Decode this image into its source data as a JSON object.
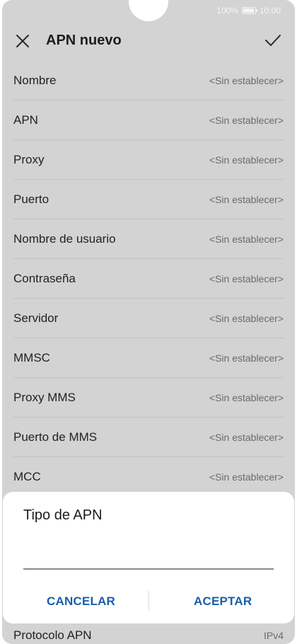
{
  "status_bar": {
    "battery_percent": "100%",
    "time": "10:00"
  },
  "toolbar": {
    "title": "APN nuevo",
    "close_icon": "close-icon",
    "confirm_icon": "check-icon"
  },
  "fields": [
    {
      "label": "Nombre",
      "value": "<Sin establecer>"
    },
    {
      "label": "APN",
      "value": "<Sin establecer>"
    },
    {
      "label": "Proxy",
      "value": "<Sin establecer>"
    },
    {
      "label": "Puerto",
      "value": "<Sin establecer>"
    },
    {
      "label": "Nombre de usuario",
      "value": "<Sin establecer>"
    },
    {
      "label": "Contraseña",
      "value": "<Sin establecer>"
    },
    {
      "label": "Servidor",
      "value": "<Sin establecer>"
    },
    {
      "label": "MMSC",
      "value": "<Sin establecer>"
    },
    {
      "label": "Proxy MMS",
      "value": "<Sin establecer>"
    },
    {
      "label": "Puerto de MMS",
      "value": "<Sin establecer>"
    },
    {
      "label": "MCC",
      "value": "<Sin establecer>"
    }
  ],
  "dialog": {
    "title": "Tipo de APN",
    "input_value": "",
    "cancel_label": "CANCELAR",
    "accept_label": "ACEPTAR"
  },
  "bottom_field": {
    "label": "Protocolo APN",
    "value": "IPv4"
  },
  "colors": {
    "accent": "#1a5fa8",
    "scrim_background": "#d3d3d3"
  }
}
